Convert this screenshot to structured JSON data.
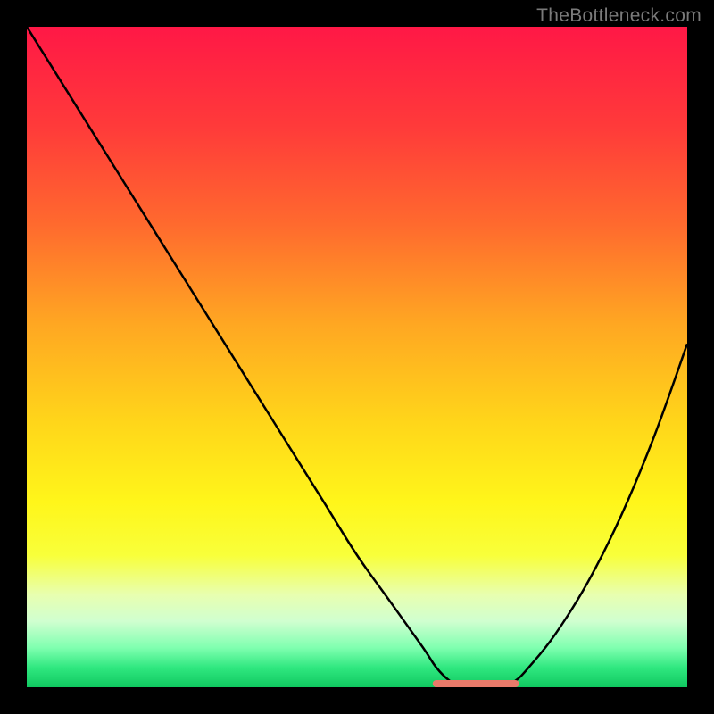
{
  "watermark": "TheBottleneck.com",
  "chart_data": {
    "type": "line",
    "title": "",
    "xlabel": "",
    "ylabel": "",
    "xlim": [
      0,
      100
    ],
    "ylim": [
      0,
      100
    ],
    "x": [
      0,
      5,
      10,
      15,
      20,
      25,
      30,
      35,
      40,
      45,
      50,
      55,
      60,
      62,
      64,
      66,
      68,
      70,
      72,
      74,
      76,
      80,
      85,
      90,
      95,
      100
    ],
    "values": [
      100,
      92,
      84,
      76,
      68,
      60,
      52,
      44,
      36,
      28,
      20,
      13,
      6,
      3,
      1,
      0,
      0,
      0,
      0,
      1,
      3,
      8,
      16,
      26,
      38,
      52
    ],
    "flat_segment": {
      "x_start": 62,
      "x_end": 74,
      "y": 0
    },
    "gradient_stops": [
      {
        "offset": 0.0,
        "color": "#ff1846"
      },
      {
        "offset": 0.15,
        "color": "#ff3a3a"
      },
      {
        "offset": 0.3,
        "color": "#ff6a2e"
      },
      {
        "offset": 0.45,
        "color": "#ffa722"
      },
      {
        "offset": 0.6,
        "color": "#ffd61a"
      },
      {
        "offset": 0.72,
        "color": "#fff61a"
      },
      {
        "offset": 0.8,
        "color": "#f8ff3a"
      },
      {
        "offset": 0.86,
        "color": "#e8ffb0"
      },
      {
        "offset": 0.9,
        "color": "#d0ffd0"
      },
      {
        "offset": 0.94,
        "color": "#80ffb0"
      },
      {
        "offset": 0.97,
        "color": "#30e880"
      },
      {
        "offset": 1.0,
        "color": "#10c860"
      }
    ],
    "highlight_color": "#e87a6a"
  }
}
